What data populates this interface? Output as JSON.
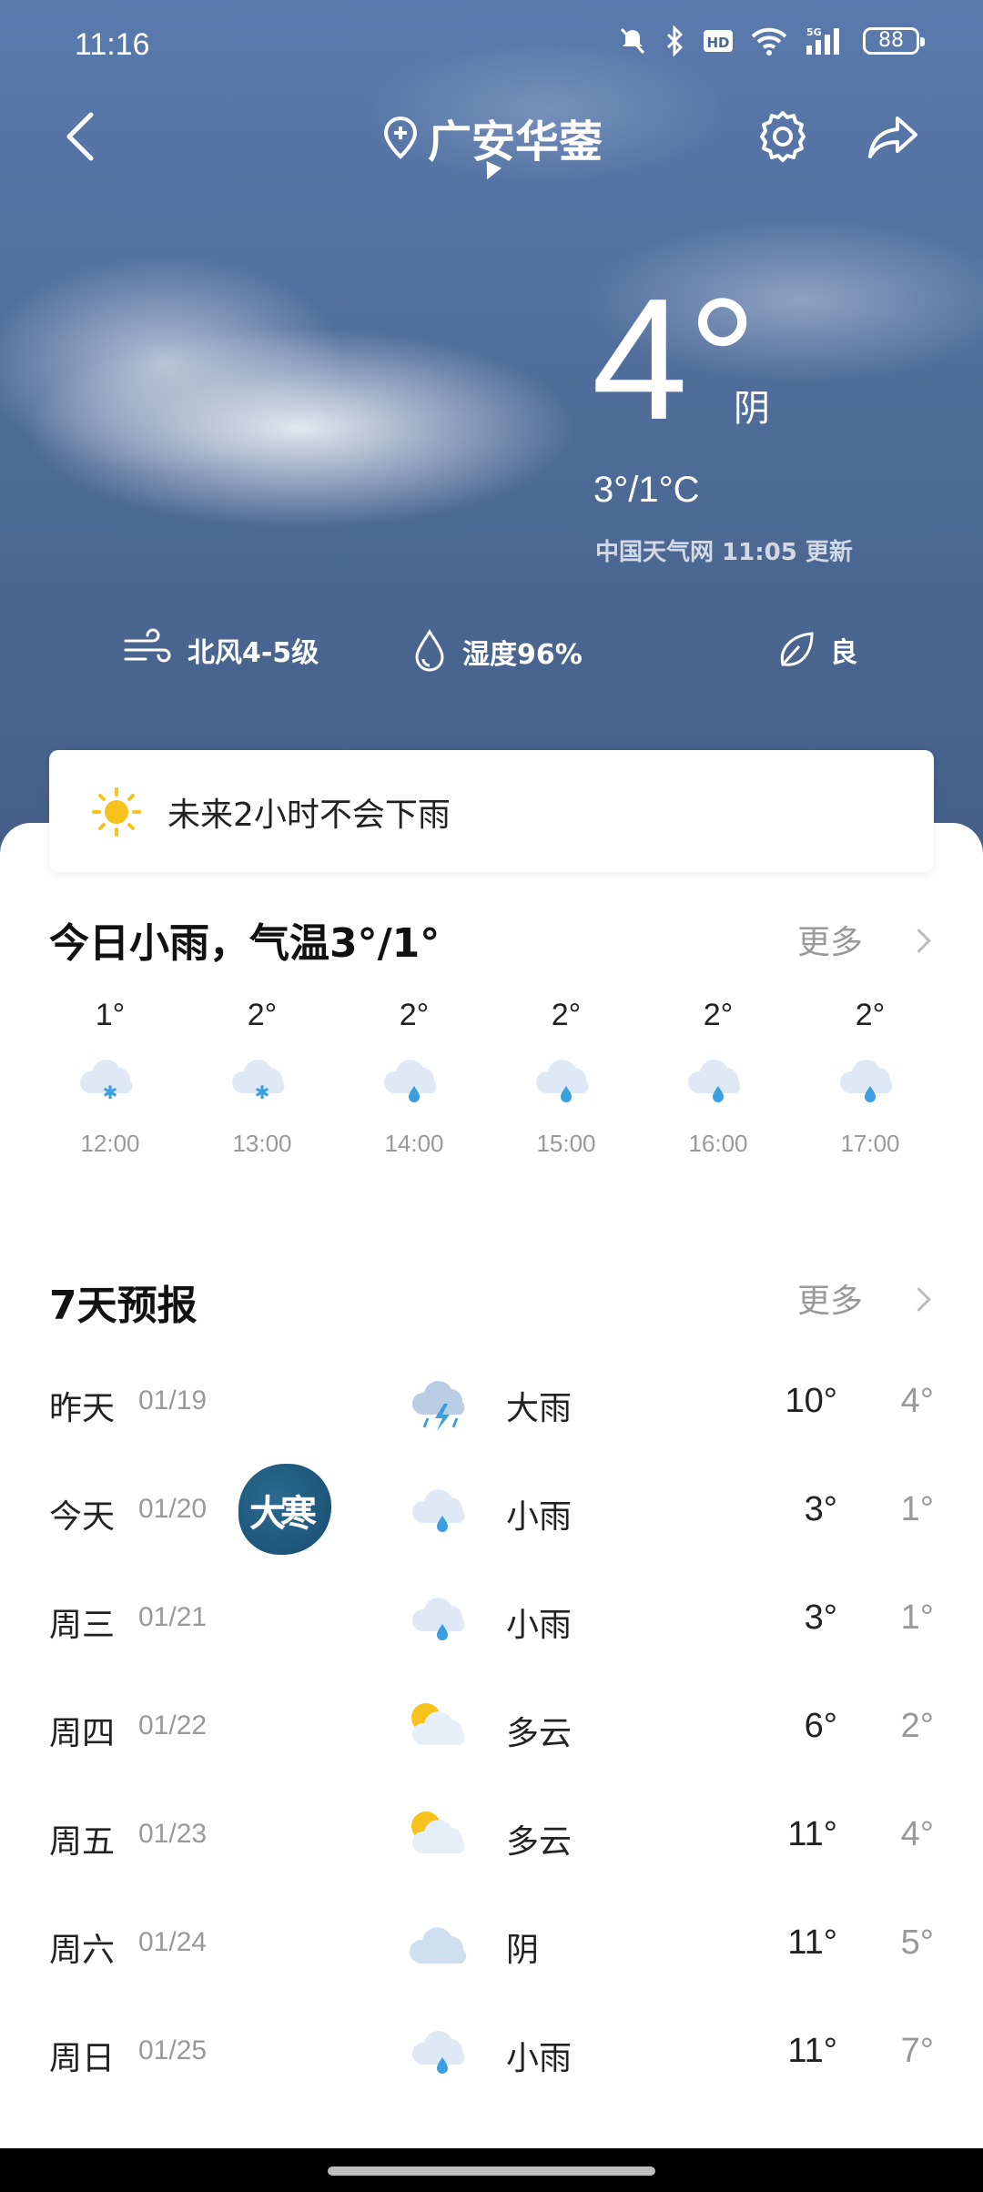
{
  "status_bar": {
    "time": "11:16",
    "battery": "88"
  },
  "header": {
    "location": "广安华蓥"
  },
  "current": {
    "temperature": "4°",
    "condition": "阴",
    "range": "3°/1°C",
    "source": "中国天气网 11:05 更新"
  },
  "metrics": [
    {
      "icon": "wind-icon",
      "label": "北风4-5级"
    },
    {
      "icon": "humidity-icon",
      "label": "湿度96%"
    },
    {
      "icon": "leaf-icon",
      "label": "良"
    }
  ],
  "alert": {
    "text": "未来2小时不会下雨"
  },
  "today": {
    "title": "今日小雨，气温3°/1°",
    "more": "更多",
    "hours": [
      {
        "temp": "1°",
        "time": "12:00",
        "icon": "snow-icon"
      },
      {
        "temp": "2°",
        "time": "13:00",
        "icon": "snow-icon"
      },
      {
        "temp": "2°",
        "time": "14:00",
        "icon": "rain-icon"
      },
      {
        "temp": "2°",
        "time": "15:00",
        "icon": "rain-icon"
      },
      {
        "temp": "2°",
        "time": "16:00",
        "icon": "rain-icon"
      },
      {
        "temp": "2°",
        "time": "17:00",
        "icon": "rain-icon"
      }
    ]
  },
  "forecast": {
    "title": "7天预报",
    "more": "更多",
    "days": [
      {
        "day": "昨天",
        "date": "01/19",
        "icon": "thunder-rain-icon",
        "cond": "大雨",
        "high": "10°",
        "low": "4°"
      },
      {
        "day": "今天",
        "date": "01/20",
        "icon": "rain-icon",
        "cond": "小雨",
        "high": "3°",
        "low": "1°"
      },
      {
        "day": "周三",
        "date": "01/21",
        "icon": "rain-icon",
        "cond": "小雨",
        "high": "3°",
        "low": "1°"
      },
      {
        "day": "周四",
        "date": "01/22",
        "icon": "partly-cloudy-icon",
        "cond": "多云",
        "high": "6°",
        "low": "2°"
      },
      {
        "day": "周五",
        "date": "01/23",
        "icon": "partly-cloudy-icon",
        "cond": "多云",
        "high": "11°",
        "low": "4°"
      },
      {
        "day": "周六",
        "date": "01/24",
        "icon": "cloudy-icon",
        "cond": "阴",
        "high": "11°",
        "low": "5°"
      },
      {
        "day": "周日",
        "date": "01/25",
        "icon": "rain-icon",
        "cond": "小雨",
        "high": "11°",
        "low": "7°"
      }
    ]
  },
  "solar_term_badge": "大寒",
  "colors": {
    "sky": "#4a6690",
    "sun": "#f6c21b",
    "rain": "#3a9fe0",
    "cloud": "#dfe9f5"
  }
}
